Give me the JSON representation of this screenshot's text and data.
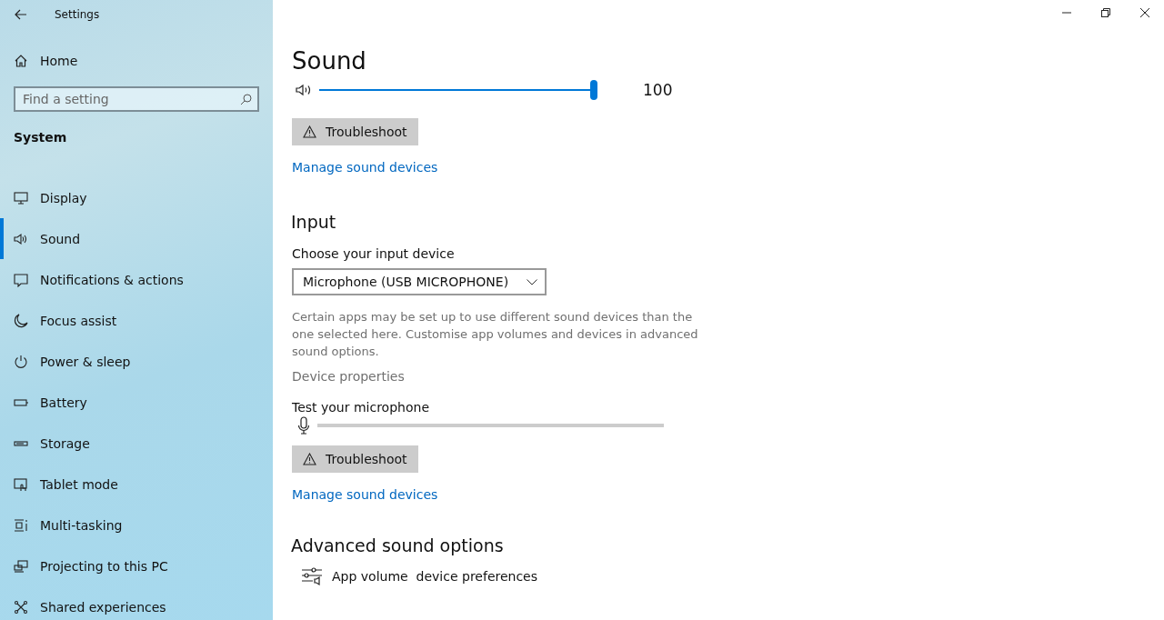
{
  "window": {
    "title": "Settings"
  },
  "sidebar": {
    "home": "Home",
    "search": {
      "placeholder": "Find a setting"
    },
    "section": "System",
    "items": [
      {
        "label": "Display",
        "kind": "display",
        "selected": false
      },
      {
        "label": "Sound",
        "kind": "sound",
        "selected": true
      },
      {
        "label": "Notifications & actions",
        "kind": "notifications",
        "selected": false
      },
      {
        "label": "Focus assist",
        "kind": "focus",
        "selected": false
      },
      {
        "label": "Power & sleep",
        "kind": "power",
        "selected": false
      },
      {
        "label": "Battery",
        "kind": "battery",
        "selected": false
      },
      {
        "label": "Storage",
        "kind": "storage",
        "selected": false
      },
      {
        "label": "Tablet mode",
        "kind": "tablet",
        "selected": false
      },
      {
        "label": "Multi-tasking",
        "kind": "multitasking",
        "selected": false
      },
      {
        "label": "Projecting to this PC",
        "kind": "projecting",
        "selected": false
      },
      {
        "label": "Shared experiences",
        "kind": "shared",
        "selected": false
      }
    ]
  },
  "page": {
    "title": "Sound",
    "volume": {
      "level": 1.0,
      "reading": "100"
    },
    "output_troubleshoot": "Troubleshoot",
    "output_manage": "Manage sound devices",
    "input": {
      "heading": "Input",
      "device_label": "Choose your input device",
      "device": "Microphone (USB MICROPHONE)",
      "note": "Certain apps may be set up to use different sound devices than the one selected here. Customise app volumes and devices in advanced sound options.",
      "properties": "Device properties",
      "test_label": "Test your microphone",
      "troubleshoot": "Troubleshoot",
      "manage": "Manage sound devices"
    },
    "advanced": {
      "heading": "Advanced sound options",
      "item": "App volume  device preferences"
    }
  }
}
